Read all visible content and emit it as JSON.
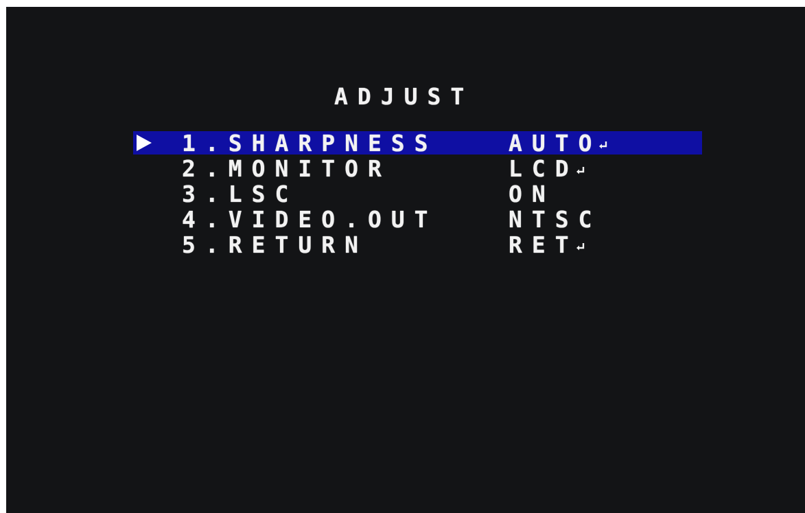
{
  "menu": {
    "title": "ADJUST",
    "selected_index": 0,
    "items": [
      {
        "label": "1.SHARPNESS",
        "value": "AUTO",
        "icon": "enter-icon"
      },
      {
        "label": "2.MONITOR",
        "value": "LCD",
        "icon": "enter-icon"
      },
      {
        "label": "3.LSC",
        "value": "ON",
        "icon": ""
      },
      {
        "label": "4.VIDEO.OUT",
        "value": "NTSC",
        "icon": ""
      },
      {
        "label": "5.RETURN",
        "value": "RET",
        "icon": "enter-icon"
      }
    ]
  },
  "colors": {
    "background": "#131416",
    "highlight": "#0f0fa3",
    "text": "#f2f2f2"
  }
}
